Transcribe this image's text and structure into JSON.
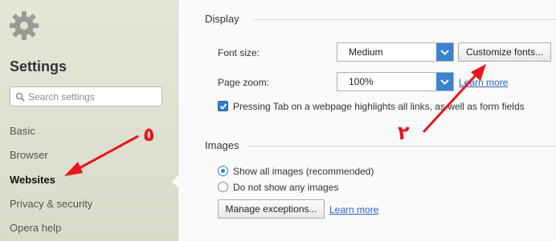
{
  "sidebar": {
    "title": "Settings",
    "search_placeholder": "Search settings",
    "items": [
      {
        "label": "Basic"
      },
      {
        "label": "Browser"
      },
      {
        "label": "Websites"
      },
      {
        "label": "Privacy & security"
      },
      {
        "label": "Opera help"
      }
    ],
    "active_item": "Websites"
  },
  "display": {
    "title": "Display",
    "font_size_label": "Font size:",
    "font_size_value": "Medium",
    "customize_fonts_label": "Customize fonts...",
    "page_zoom_label": "Page zoom:",
    "page_zoom_value": "100%",
    "learn_more_label": "Learn more",
    "tab_highlight_label": "Pressing Tab on a webpage highlights all links, as well as form fields",
    "tab_highlight_checked": true
  },
  "images": {
    "title": "Images",
    "options": [
      {
        "label": "Show all images (recommended)",
        "selected": true
      },
      {
        "label": "Do not show any images",
        "selected": false
      }
    ],
    "manage_exceptions_label": "Manage exceptions...",
    "learn_more_label": "Learn more"
  },
  "annotations": {
    "arrow_color": "#e8141b",
    "left_marker_text": "٥",
    "right_marker_text": "٢"
  },
  "colors": {
    "accent": "#3b83cf",
    "link": "#2a63c7"
  }
}
